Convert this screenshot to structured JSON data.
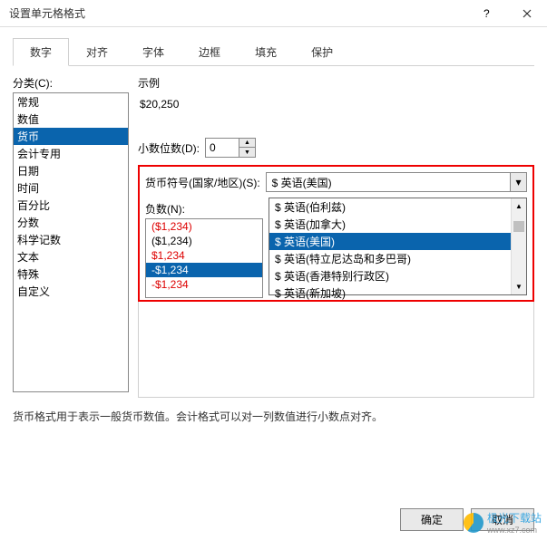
{
  "window": {
    "title": "设置单元格格式"
  },
  "tabs": [
    "数字",
    "对齐",
    "字体",
    "边框",
    "填充",
    "保护"
  ],
  "activeTab": 0,
  "left": {
    "label": "分类(C):",
    "items": [
      "常规",
      "数值",
      "货币",
      "会计专用",
      "日期",
      "时间",
      "百分比",
      "分数",
      "科学记数",
      "文本",
      "特殊",
      "自定义"
    ],
    "selectedIndex": 2
  },
  "sample": {
    "label": "示例",
    "value": "$20,250"
  },
  "decimals": {
    "label": "小数位数(D):",
    "value": "0"
  },
  "symbol": {
    "label": "货币符号(国家/地区)(S):",
    "value": "$ 英语(美国)"
  },
  "dropdown": {
    "items": [
      "$ 英语(伯利兹)",
      "$ 英语(加拿大)",
      "$ 英语(美国)",
      "$ 英语(特立尼达岛和多巴哥)",
      "$ 英语(香港特别行政区)",
      "$ 英语(新加坡)"
    ],
    "highlightIndex": 2
  },
  "negatives": {
    "label": "负数(N):",
    "items": [
      {
        "text": "($1,234)",
        "red": true
      },
      {
        "text": "($1,234)",
        "red": false
      },
      {
        "text": "$1,234",
        "red": true
      },
      {
        "text": "-$1,234",
        "red": false,
        "selected": true
      },
      {
        "text": "-$1,234",
        "red": true
      }
    ]
  },
  "desc": "货币格式用于表示一般货币数值。会计格式可以对一列数值进行小数点对齐。",
  "buttons": {
    "ok": "确定",
    "cancel": "取消"
  },
  "watermark": {
    "brand": "极光下载站",
    "url": "www.xz7.com"
  }
}
